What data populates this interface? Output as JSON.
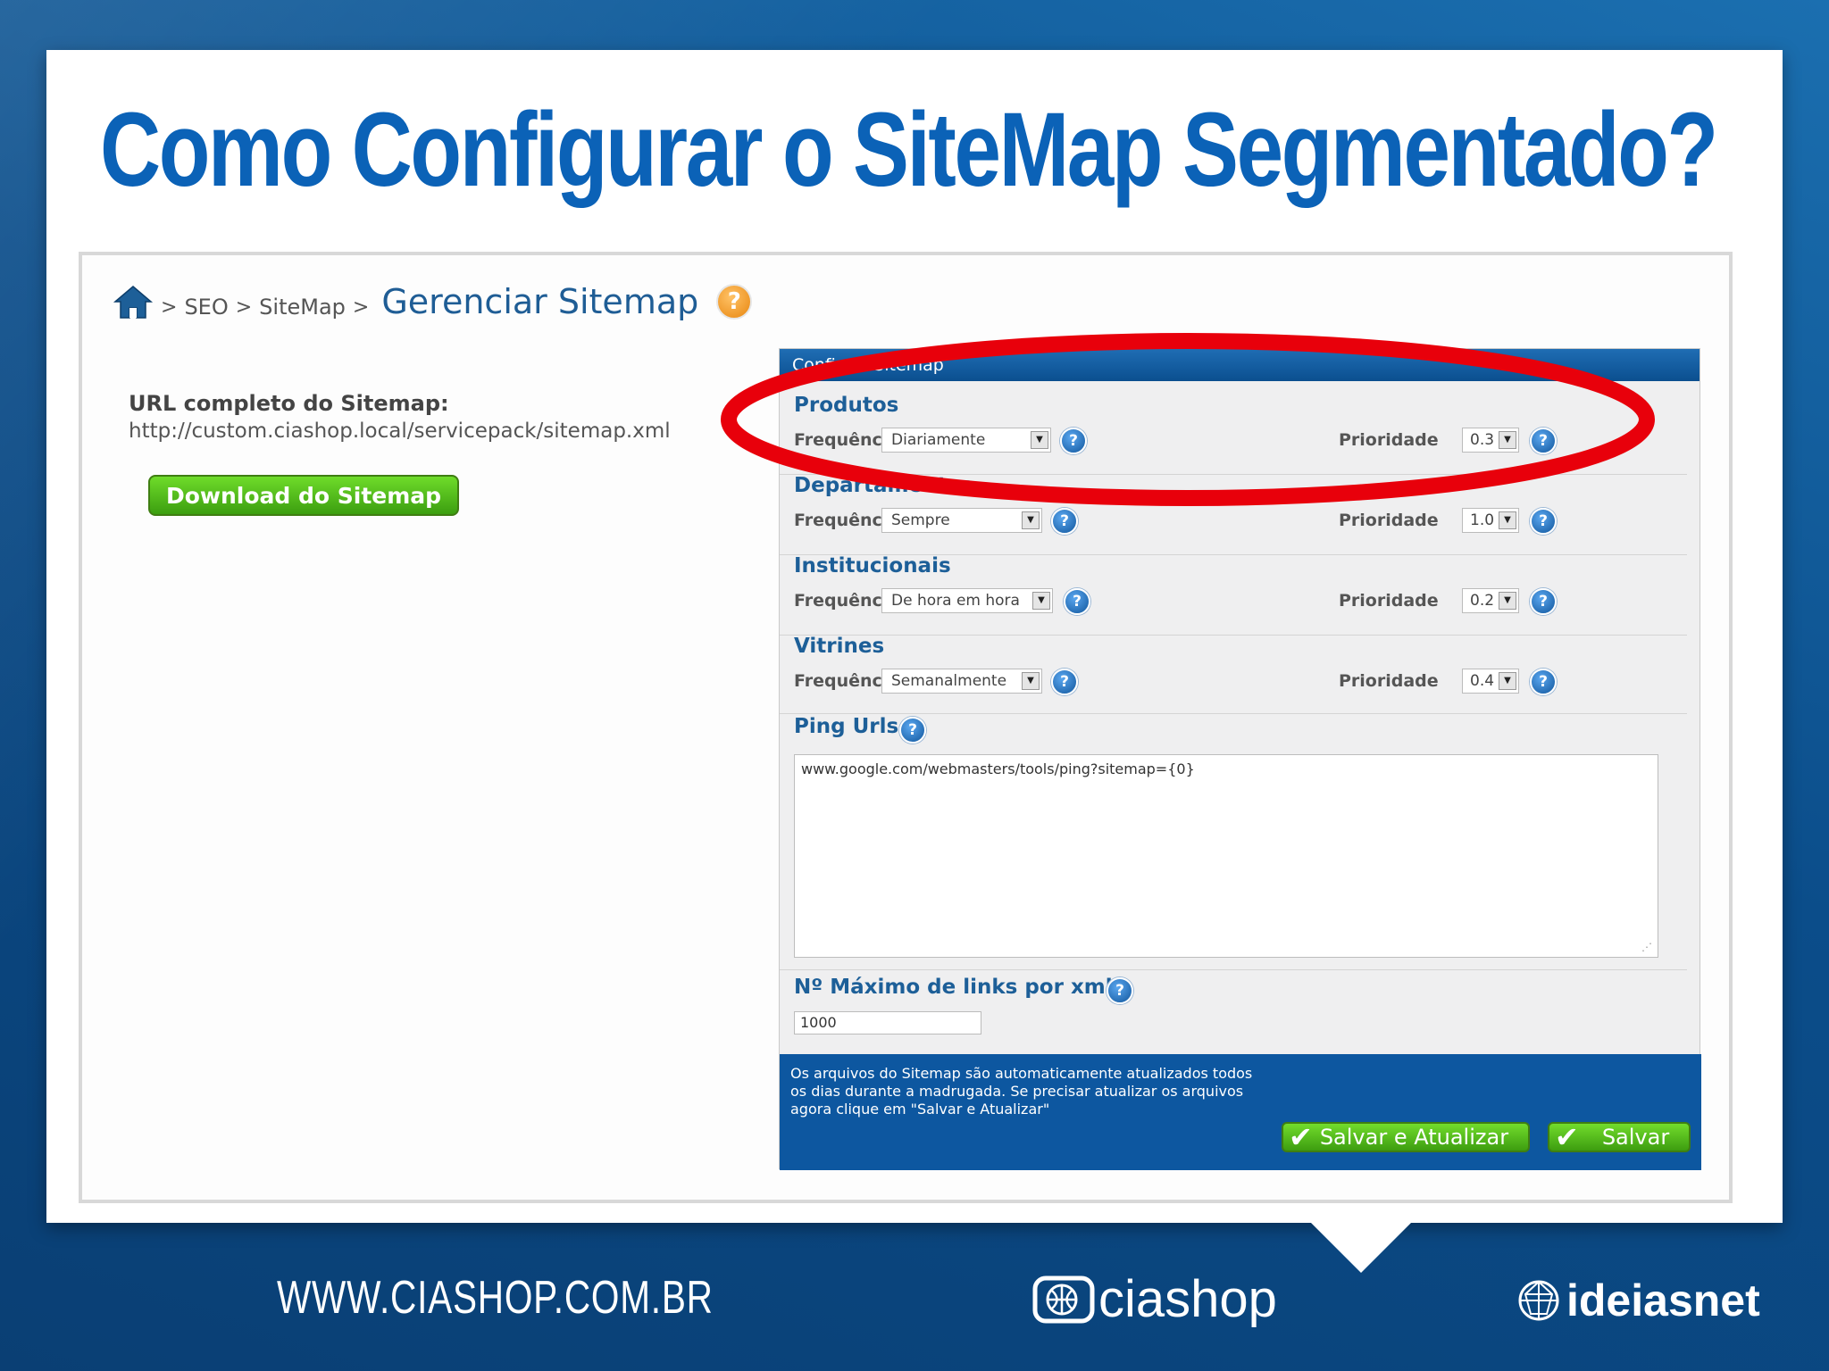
{
  "slide": {
    "title": "Como Configurar o SiteMap Segmentado?"
  },
  "breadcrumb": {
    "sep": ">",
    "items": [
      "SEO",
      "SiteMap"
    ],
    "current": "Gerenciar Sitemap",
    "help": "?"
  },
  "sitemap": {
    "url_label": "URL completo do Sitemap:",
    "url_value": "http://custom.ciashop.local/servicepack/sitemap.xml",
    "download_label": "Download do Sitemap"
  },
  "panel": {
    "header": "Config     Sitemap",
    "freq_label": "Frequência",
    "prio_label": "Prioridade",
    "help": "?",
    "sections": [
      {
        "title": "Produtos",
        "frequency": "Diariamente",
        "priority": "0.3"
      },
      {
        "title": "Departamentos",
        "frequency": "Sempre",
        "priority": "1.0"
      },
      {
        "title": "Institucionais",
        "frequency": "De hora em hora",
        "priority": "0.2"
      },
      {
        "title": "Vitrines",
        "frequency": "Semanalmente",
        "priority": "0.4"
      }
    ],
    "ping_label": "Ping Urls",
    "ping_value": "www.google.com/webmasters/tools/ping?sitemap={0}",
    "max_links_label": "Nº Máximo de links por xml",
    "max_links_value": "1000",
    "footer_lines": [
      "Os arquivos do Sitemap são automaticamente atualizados todos",
      "os dias durante a madrugada. Se precisar atualizar os arquivos",
      "agora clique em \"Salvar e Atualizar\""
    ],
    "save_update_label": "Salvar e Atualizar",
    "save_label": "Salvar"
  },
  "footer": {
    "site": "WWW.CIASHOP.COM.BR",
    "brand1": "ciashop",
    "brand2": "ideiasnet"
  },
  "colors": {
    "title": "#0b62b7",
    "highlight": "#e8000b",
    "panel_blue": "#0d57a0",
    "button_green": "#4fb81a"
  },
  "icons": [
    "home-icon",
    "help-icon",
    "dropdown-arrow-icon",
    "checkmark-icon",
    "globe-icon"
  ]
}
